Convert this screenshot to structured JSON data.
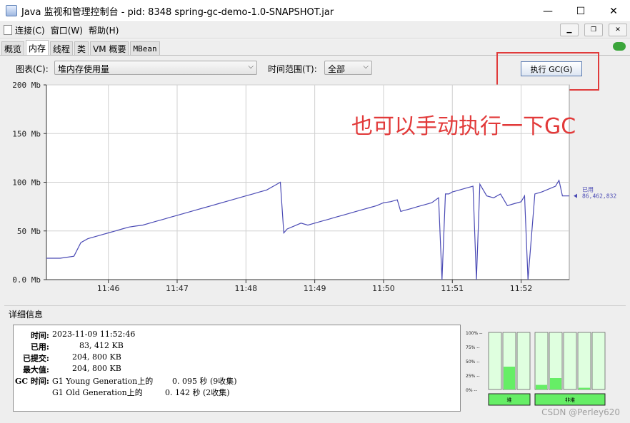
{
  "window": {
    "title": "Java 监视和管理控制台 - pid: 8348 spring-gc-demo-1.0-SNAPSHOT.jar",
    "minimize": "—",
    "maximize": "☐",
    "close": "✕"
  },
  "menu": {
    "items": [
      "连接(C)",
      "窗口(W)",
      "帮助(H)"
    ],
    "mdi_min": "▁",
    "mdi_restore": "❐",
    "mdi_close": "✕"
  },
  "tabs": [
    {
      "label": "概览",
      "active": false
    },
    {
      "label": "内存",
      "active": true
    },
    {
      "label": "线程",
      "active": false
    },
    {
      "label": "类",
      "active": false
    },
    {
      "label": "VM 概要",
      "active": false
    },
    {
      "label": "MBean",
      "active": false
    }
  ],
  "toolbar": {
    "chart_label": "图表(C):",
    "chart_value": "堆内存使用量",
    "range_label": "时间范围(T):",
    "range_value": "全部",
    "gc_button": "执行 GC(G)"
  },
  "annotation": "也可以手动执行一下GC",
  "chart_data": {
    "type": "line",
    "ylim": [
      0,
      200
    ],
    "yticks": [
      "200 Mb",
      "150 Mb",
      "100 Mb",
      "50 Mb",
      "0.0 Mb"
    ],
    "ytick_values": [
      200,
      150,
      100,
      50,
      0
    ],
    "xticks": [
      "11:46",
      "11:47",
      "11:48",
      "11:49",
      "11:50",
      "11:51",
      "11:52"
    ],
    "xtick_minutes": [
      46,
      47,
      48,
      49,
      50,
      51,
      52
    ],
    "xlim_minutes": [
      45.1,
      52.7
    ],
    "series": [
      {
        "name": "已用",
        "color": "#4b4bb5",
        "x": [
          45.1,
          45.2,
          45.3,
          45.4,
          45.5,
          45.6,
          45.7,
          45.8,
          45.9,
          46.0,
          46.1,
          46.2,
          46.3,
          46.4,
          46.5,
          46.6,
          46.7,
          46.8,
          46.9,
          47.0,
          47.1,
          47.2,
          47.3,
          47.4,
          47.5,
          47.6,
          47.7,
          47.8,
          47.9,
          48.0,
          48.1,
          48.2,
          48.3,
          48.4,
          48.5,
          48.55,
          48.6,
          48.7,
          48.8,
          48.9,
          49.0,
          49.1,
          49.2,
          49.3,
          49.4,
          49.5,
          49.6,
          49.7,
          49.8,
          49.9,
          50.0,
          50.1,
          50.2,
          50.25,
          50.3,
          50.4,
          50.5,
          50.6,
          50.7,
          50.8,
          50.85,
          50.9,
          50.95,
          51.0,
          51.1,
          51.2,
          51.3,
          51.35,
          51.4,
          51.5,
          51.6,
          51.7,
          51.8,
          51.9,
          52.0,
          52.05,
          52.1,
          52.2,
          52.3,
          52.4,
          52.5,
          52.55,
          52.6,
          52.7
        ],
        "y": [
          22,
          22,
          22,
          23,
          24,
          38,
          42,
          44,
          46,
          48,
          50,
          52,
          54,
          55,
          56,
          58,
          60,
          62,
          64,
          66,
          68,
          70,
          72,
          74,
          76,
          78,
          80,
          82,
          84,
          86,
          88,
          90,
          92,
          96,
          100,
          48,
          52,
          55,
          58,
          56,
          58,
          60,
          62,
          64,
          66,
          68,
          70,
          72,
          74,
          76,
          79,
          80,
          82,
          70,
          71,
          73,
          75,
          77,
          79,
          84,
          0,
          88,
          88,
          90,
          92,
          94,
          96,
          0,
          98,
          86,
          84,
          88,
          76,
          78,
          80,
          86,
          0,
          88,
          90,
          93,
          96,
          102,
          86,
          86
        ],
        "current_label": "已用",
        "current_value": "86,462,832"
      }
    ],
    "grid": true
  },
  "details": {
    "title": "详细信息",
    "rows": [
      {
        "label": "时间:",
        "value": "2023-11-09 11:52:46"
      },
      {
        "label": "已用:",
        "value": "83, 412 KB"
      },
      {
        "label": "已提交:",
        "value": "204, 800 KB"
      },
      {
        "label": "最大值:",
        "value": "204, 800 KB"
      }
    ],
    "gc_label": "GC 时间:",
    "gc_rows": [
      {
        "name": "G1 Young Generation上的",
        "value": "0. 095  秒 (9收集)"
      },
      {
        "name": "G1 Old Generation上的",
        "value": "0. 142  秒 (2收集)"
      }
    ]
  },
  "pools": {
    "scale": [
      "100%",
      "75%",
      "50%",
      "25%",
      "0%"
    ],
    "group1_label": "堆",
    "group2_label": "非堆",
    "heap_bars": [
      0.0,
      0.4,
      0.0
    ],
    "nonheap_bars": [
      0.08,
      0.2,
      0.0,
      0.03
    ]
  },
  "watermark": "CSDN @Perley620"
}
